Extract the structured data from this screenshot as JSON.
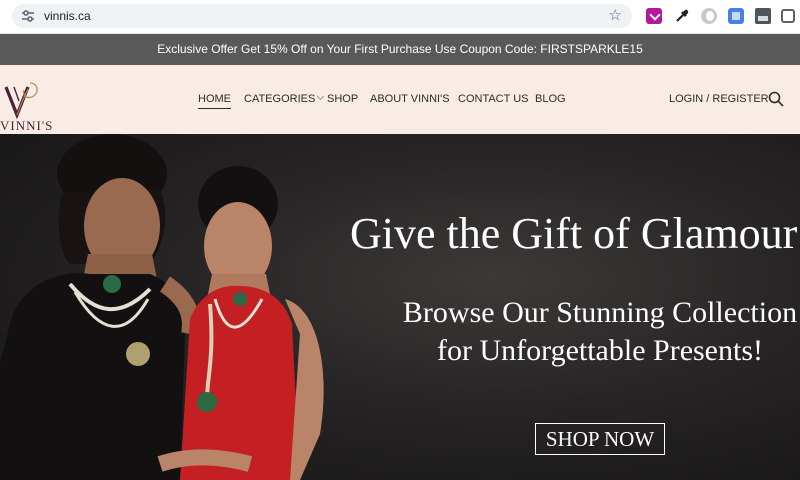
{
  "browser": {
    "url": "vinnis.ca",
    "extensions": [
      "download-extension-icon",
      "eyedropper-icon",
      "circle-extension-icon",
      "translate-icon",
      "image-extension-icon",
      "puzzle-icon"
    ]
  },
  "promo": {
    "text": "Exclusive Offer Get 15% Off on Your First Purchase Use Coupon Code: FIRSTSPARKLE15"
  },
  "header": {
    "logo_text": "VINNI'S",
    "nav": [
      {
        "label": "HOME",
        "active": true
      },
      {
        "label": "CATEGORIES",
        "has_dropdown": true
      },
      {
        "label": "SHOP"
      },
      {
        "label": "ABOUT VINNI'S"
      },
      {
        "label": "CONTACT US"
      },
      {
        "label": "BLOG"
      }
    ],
    "login_label": "LOGIN / REGISTER"
  },
  "hero": {
    "title": "Give the Gift of Glamour",
    "subtitle_line1": "Browse Our Stunning Collection",
    "subtitle_line2": "for Unforgettable Presents!",
    "button_label": "SHOP NOW"
  },
  "colors": {
    "promo_bg": "#595959",
    "header_bg": "#f8ece4",
    "brand": "#4b2237",
    "hero_bg": "#262424",
    "dress_red": "#c41f22"
  }
}
